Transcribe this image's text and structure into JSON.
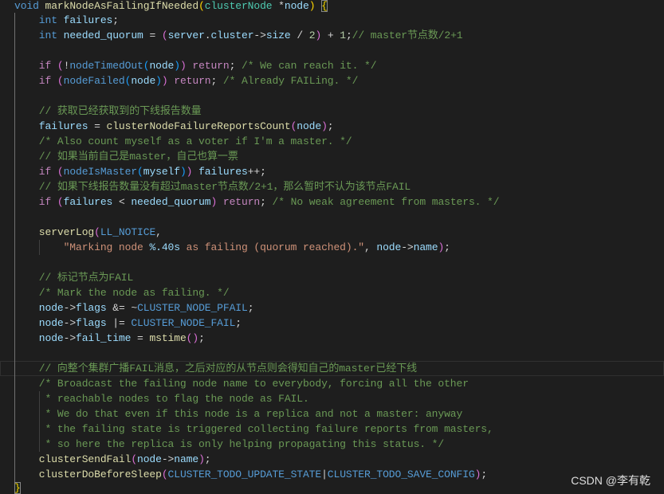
{
  "theme": {
    "background": "#1e1e1e",
    "current_line_border": "#303030",
    "indent_guide": "#404040",
    "indent_guide_active": "#707070",
    "bracket_match_border": "#888888",
    "watermark_color": "#ffffff"
  },
  "editor": {
    "current_line_index": 24,
    "lines": [
      [
        [
          "void",
          "#569cd6"
        ],
        [
          " ",
          "#d4d4d4"
        ],
        [
          "markNodeAsFailingIfNeeded",
          "#dcdcaa"
        ],
        [
          "(",
          "#ffd700"
        ],
        [
          "clusterNode",
          "#4ec9b0"
        ],
        [
          " *",
          "#d4d4d4"
        ],
        [
          "node",
          "#9cdcfe"
        ],
        [
          ")",
          "#ffd700"
        ],
        [
          " ",
          "#d4d4d4"
        ],
        [
          "{",
          "#ffd700",
          true
        ]
      ],
      [
        [
          "    int",
          "#569cd6"
        ],
        [
          " ",
          "#d4d4d4"
        ],
        [
          "failures",
          "#9cdcfe"
        ],
        [
          ";",
          "#d4d4d4"
        ]
      ],
      [
        [
          "    int",
          "#569cd6"
        ],
        [
          " ",
          "#d4d4d4"
        ],
        [
          "needed_quorum",
          "#9cdcfe"
        ],
        [
          " = ",
          "#d4d4d4"
        ],
        [
          "(",
          "#da70d6"
        ],
        [
          "server",
          "#9cdcfe"
        ],
        [
          ".",
          "#d4d4d4"
        ],
        [
          "cluster",
          "#9cdcfe"
        ],
        [
          "->",
          "#d4d4d4"
        ],
        [
          "size",
          "#9cdcfe"
        ],
        [
          " / ",
          "#d4d4d4"
        ],
        [
          "2",
          "#b5cea8"
        ],
        [
          ")",
          "#da70d6"
        ],
        [
          " + ",
          "#d4d4d4"
        ],
        [
          "1",
          "#b5cea8"
        ],
        [
          ";",
          "#d4d4d4"
        ],
        [
          "// master节点数/2+1",
          "#6a9955"
        ]
      ],
      [],
      [
        [
          "    if",
          "#c586c0"
        ],
        [
          " ",
          "#d4d4d4"
        ],
        [
          "(",
          "#da70d6"
        ],
        [
          "!",
          "#d4d4d4"
        ],
        [
          "nodeTimedOut",
          "#569cd6"
        ],
        [
          "(",
          "#179fff"
        ],
        [
          "node",
          "#9cdcfe"
        ],
        [
          ")",
          "#179fff"
        ],
        [
          ")",
          "#da70d6"
        ],
        [
          " ",
          "#d4d4d4"
        ],
        [
          "return",
          "#c586c0"
        ],
        [
          "; ",
          "#d4d4d4"
        ],
        [
          "/* We can reach it. */",
          "#6a9955"
        ]
      ],
      [
        [
          "    if",
          "#c586c0"
        ],
        [
          " ",
          "#d4d4d4"
        ],
        [
          "(",
          "#da70d6"
        ],
        [
          "nodeFailed",
          "#569cd6"
        ],
        [
          "(",
          "#179fff"
        ],
        [
          "node",
          "#9cdcfe"
        ],
        [
          ")",
          "#179fff"
        ],
        [
          ")",
          "#da70d6"
        ],
        [
          " ",
          "#d4d4d4"
        ],
        [
          "return",
          "#c586c0"
        ],
        [
          "; ",
          "#d4d4d4"
        ],
        [
          "/* Already FAILing. */",
          "#6a9955"
        ]
      ],
      [],
      [
        [
          "    // 获取已经获取到的下线报告数量",
          "#6a9955"
        ]
      ],
      [
        [
          "    failures",
          "#9cdcfe"
        ],
        [
          " = ",
          "#d4d4d4"
        ],
        [
          "clusterNodeFailureReportsCount",
          "#dcdcaa"
        ],
        [
          "(",
          "#da70d6"
        ],
        [
          "node",
          "#9cdcfe"
        ],
        [
          ")",
          "#da70d6"
        ],
        [
          ";",
          "#d4d4d4"
        ]
      ],
      [
        [
          "    /* Also count myself as a voter if I'm a master. */",
          "#6a9955"
        ]
      ],
      [
        [
          "    // 如果当前自己是master，自己也算一票",
          "#6a9955"
        ]
      ],
      [
        [
          "    if",
          "#c586c0"
        ],
        [
          " ",
          "#d4d4d4"
        ],
        [
          "(",
          "#da70d6"
        ],
        [
          "nodeIsMaster",
          "#569cd6"
        ],
        [
          "(",
          "#179fff"
        ],
        [
          "myself",
          "#9cdcfe"
        ],
        [
          ")",
          "#179fff"
        ],
        [
          ")",
          "#da70d6"
        ],
        [
          " ",
          "#d4d4d4"
        ],
        [
          "failures",
          "#9cdcfe"
        ],
        [
          "++;",
          "#d4d4d4"
        ]
      ],
      [
        [
          "    // 如果下线报告数量没有超过master节点数/2+1，那么暂时不认为该节点FAIL",
          "#6a9955"
        ]
      ],
      [
        [
          "    if",
          "#c586c0"
        ],
        [
          " ",
          "#d4d4d4"
        ],
        [
          "(",
          "#da70d6"
        ],
        [
          "failures",
          "#9cdcfe"
        ],
        [
          " < ",
          "#d4d4d4"
        ],
        [
          "needed_quorum",
          "#9cdcfe"
        ],
        [
          ")",
          "#da70d6"
        ],
        [
          " ",
          "#d4d4d4"
        ],
        [
          "return",
          "#c586c0"
        ],
        [
          "; ",
          "#d4d4d4"
        ],
        [
          "/* No weak agreement from masters. */",
          "#6a9955"
        ]
      ],
      [],
      [
        [
          "    serverLog",
          "#dcdcaa"
        ],
        [
          "(",
          "#da70d6"
        ],
        [
          "LL_NOTICE",
          "#569cd6"
        ],
        [
          ",",
          "#d4d4d4"
        ]
      ],
      [
        [
          "        \"Marking node ",
          "#ce9178"
        ],
        [
          "%.40s",
          "#9cdcfe"
        ],
        [
          " as failing (quorum reached).\"",
          "#ce9178"
        ],
        [
          ", ",
          "#d4d4d4"
        ],
        [
          "node",
          "#9cdcfe"
        ],
        [
          "->",
          "#d4d4d4"
        ],
        [
          "name",
          "#9cdcfe"
        ],
        [
          ")",
          "#da70d6"
        ],
        [
          ";",
          "#d4d4d4"
        ]
      ],
      [],
      [
        [
          "    // 标记节点为FAIL",
          "#6a9955"
        ]
      ],
      [
        [
          "    /* Mark the node as failing. */",
          "#6a9955"
        ]
      ],
      [
        [
          "    node",
          "#9cdcfe"
        ],
        [
          "->",
          "#d4d4d4"
        ],
        [
          "flags",
          "#9cdcfe"
        ],
        [
          " &= ~",
          "#d4d4d4"
        ],
        [
          "CLUSTER_NODE_PFAIL",
          "#569cd6"
        ],
        [
          ";",
          "#d4d4d4"
        ]
      ],
      [
        [
          "    node",
          "#9cdcfe"
        ],
        [
          "->",
          "#d4d4d4"
        ],
        [
          "flags",
          "#9cdcfe"
        ],
        [
          " |= ",
          "#d4d4d4"
        ],
        [
          "CLUSTER_NODE_FAIL",
          "#569cd6"
        ],
        [
          ";",
          "#d4d4d4"
        ]
      ],
      [
        [
          "    node",
          "#9cdcfe"
        ],
        [
          "->",
          "#d4d4d4"
        ],
        [
          "fail_time",
          "#9cdcfe"
        ],
        [
          " = ",
          "#d4d4d4"
        ],
        [
          "mstime",
          "#dcdcaa"
        ],
        [
          "()",
          "#da70d6"
        ],
        [
          ";",
          "#d4d4d4"
        ]
      ],
      [],
      [
        [
          "    // 向整个集群广播FAIL消息，之后对应的从节点则会得知自己的master已经下线",
          "#6a9955"
        ]
      ],
      [
        [
          "    /* Broadcast the failing node name to everybody, forcing all the other",
          "#6a9955"
        ]
      ],
      [
        [
          "     * reachable nodes to flag the node as FAIL.",
          "#6a9955"
        ]
      ],
      [
        [
          "     * We do that even if this node is a replica and not a master: anyway",
          "#6a9955"
        ]
      ],
      [
        [
          "     * the failing state is triggered collecting failure reports from masters,",
          "#6a9955"
        ]
      ],
      [
        [
          "     * so here the replica is only helping propagating this status. */",
          "#6a9955"
        ]
      ],
      [
        [
          "    clusterSendFail",
          "#dcdcaa"
        ],
        [
          "(",
          "#da70d6"
        ],
        [
          "node",
          "#9cdcfe"
        ],
        [
          "->",
          "#d4d4d4"
        ],
        [
          "name",
          "#9cdcfe"
        ],
        [
          ")",
          "#da70d6"
        ],
        [
          ";",
          "#d4d4d4"
        ]
      ],
      [
        [
          "    clusterDoBeforeSleep",
          "#dcdcaa"
        ],
        [
          "(",
          "#da70d6"
        ],
        [
          "CLUSTER_TODO_UPDATE_STATE",
          "#569cd6"
        ],
        [
          "|",
          "#d4d4d4"
        ],
        [
          "CLUSTER_TODO_SAVE_CONFIG",
          "#569cd6"
        ],
        [
          ")",
          "#da70d6"
        ],
        [
          ";",
          "#d4d4d4"
        ]
      ],
      [
        [
          "}",
          "#ffd700",
          true
        ]
      ]
    ]
  },
  "watermark": "CSDN @李有乾"
}
